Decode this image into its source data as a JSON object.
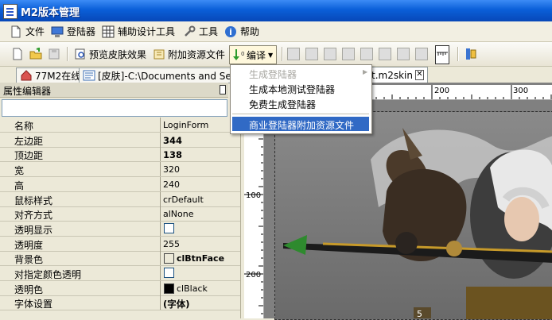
{
  "window": {
    "title": "M2版本管理"
  },
  "menu": [
    {
      "label": "文件",
      "icon": "document-icon"
    },
    {
      "label": "登陆器",
      "icon": "monitor-icon"
    },
    {
      "label": "辅助设计工具",
      "icon": "grid-icon"
    },
    {
      "label": "工具",
      "icon": "wrench-icon"
    },
    {
      "label": "帮助",
      "icon": "help-icon"
    }
  ],
  "toolbar": {
    "preview_label": "预览皮肤效果",
    "attach_label": "附加资源文件",
    "compile_label": "编译"
  },
  "tabs": [
    {
      "label": "77M2在线"
    },
    {
      "label": "[皮肤]-C:\\Documents and Settings"
    },
    {
      "label": "t.m2skin"
    }
  ],
  "property_editor": {
    "title": "属性编辑器",
    "rows": [
      {
        "name": "名称",
        "value": "LoginForm",
        "style": "text"
      },
      {
        "name": "左边距",
        "value": "344",
        "style": "bold"
      },
      {
        "name": "顶边距",
        "value": "138",
        "style": "bold"
      },
      {
        "name": "宽",
        "value": "320",
        "style": "text"
      },
      {
        "name": "高",
        "value": "240",
        "style": "text"
      },
      {
        "name": "鼠标样式",
        "value": "crDefault",
        "style": "text"
      },
      {
        "name": "对齐方式",
        "value": "alNone",
        "style": "text"
      },
      {
        "name": "透明显示",
        "value": "",
        "style": "checkbox"
      },
      {
        "name": "透明度",
        "value": "255",
        "style": "text"
      },
      {
        "name": "背景色",
        "value": "clBtnFace",
        "style": "color",
        "color": "#ece9d8"
      },
      {
        "name": "对指定颜色透明",
        "value": "",
        "style": "checkbox"
      },
      {
        "name": "透明色",
        "value": "clBlack",
        "style": "color",
        "color": "#000000"
      },
      {
        "name": "字体设置",
        "value": "(字体)",
        "style": "bold"
      }
    ]
  },
  "ruler": {
    "h_ticks": [
      "200",
      "300"
    ],
    "v_ticks": [
      "100",
      "200"
    ]
  },
  "compile_menu": [
    {
      "label": "生成登陆器",
      "disabled": true,
      "submenu": true
    },
    {
      "label": "生成本地测试登陆器",
      "disabled": false
    },
    {
      "label": "免费生成登陆器",
      "disabled": false
    },
    {
      "label": "商业登陆器附加资源文件",
      "disabled": false,
      "selected": true
    }
  ],
  "canvas": {
    "badge": "5"
  }
}
